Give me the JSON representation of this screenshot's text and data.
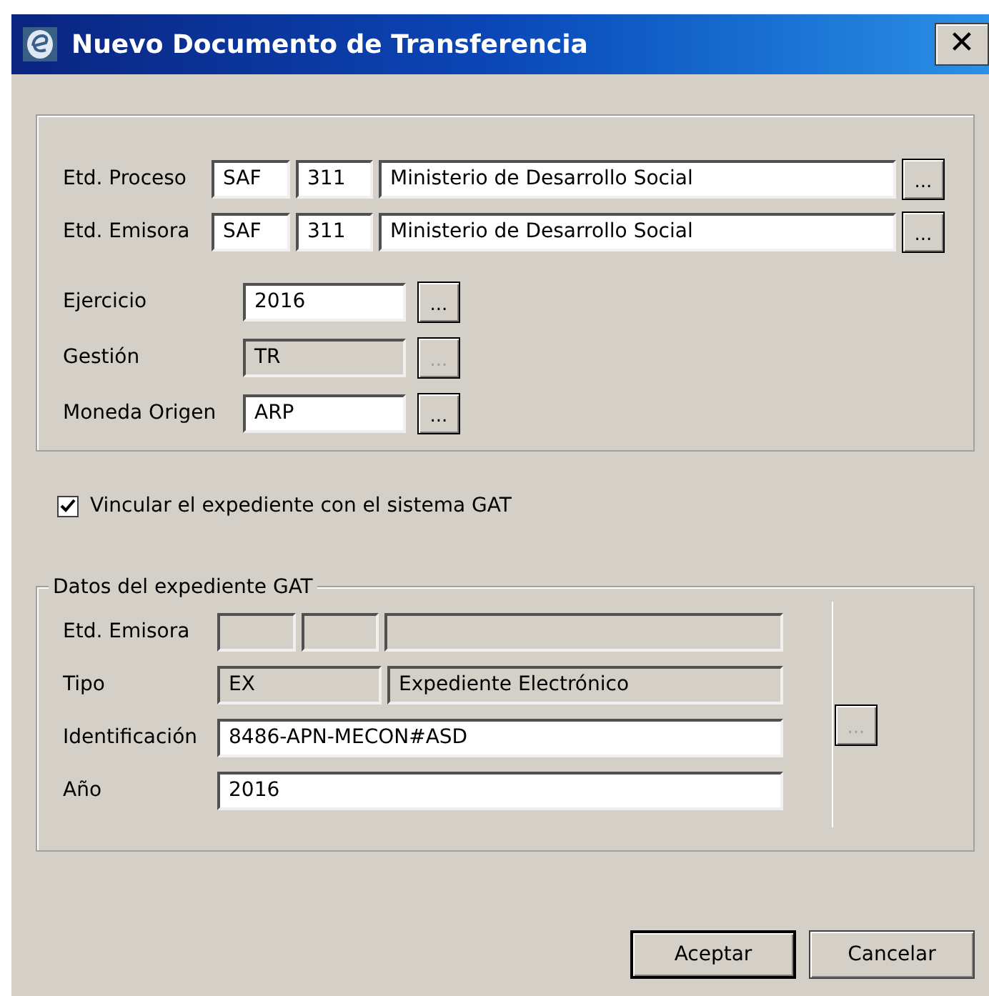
{
  "window": {
    "title": "Nuevo Documento de Transferencia",
    "close": "✕"
  },
  "entity_rows": [
    {
      "label": "Etd. Proceso",
      "code": "SAF",
      "number": "311",
      "name": "Ministerio de Desarrollo Social",
      "lookup": "..."
    },
    {
      "label": "Etd. Emisora",
      "code": "SAF",
      "number": "311",
      "name": "Ministerio de Desarrollo Social",
      "lookup": "..."
    }
  ],
  "fields": [
    {
      "label": "Ejercicio",
      "value": "2016",
      "disabled": false,
      "lookup": "..."
    },
    {
      "label": "Gestión",
      "value": "TR",
      "disabled": true,
      "lookup": "..."
    },
    {
      "label": "Moneda Origen",
      "value": "ARP",
      "disabled": false,
      "lookup": "..."
    }
  ],
  "link_checkbox": {
    "label": "Vincular el expediente con el sistema GAT",
    "checked": true
  },
  "gat": {
    "legend": "Datos del expediente GAT",
    "lookup": "...",
    "lookup_disabled": true,
    "rows": [
      {
        "label": "Etd. Emisora",
        "kind": "triple",
        "disabled": true,
        "values": []
      },
      {
        "label": "Tipo",
        "kind": "pair",
        "disabled": true,
        "values": [
          "EX",
          "Expediente Electrónico"
        ]
      },
      {
        "label": "Identificación",
        "kind": "single",
        "disabled": false,
        "values": [
          "8486-APN-MECON#ASD"
        ]
      },
      {
        "label": "Año",
        "kind": "single",
        "disabled": false,
        "values": [
          "2016"
        ]
      }
    ]
  },
  "buttons": [
    {
      "label": "Aceptar",
      "default": true
    },
    {
      "label": "Cancelar",
      "default": false
    }
  ]
}
